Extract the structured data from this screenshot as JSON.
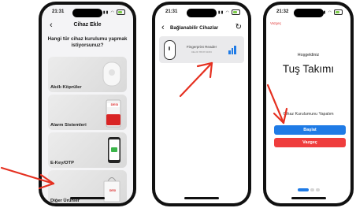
{
  "phone1": {
    "status_time": "21:31",
    "back_icon": "chevron-left-icon",
    "title": "Cihaz Ekle",
    "question": "Hangi tür cihaz kurulumu yapmak istiyorsunuz?",
    "categories": [
      {
        "label": "Akıllı Köprüler"
      },
      {
        "label": "Alarm Sistemleri",
        "device_text": "DESI"
      },
      {
        "label": "E-Key/OTP"
      },
      {
        "label": "Diğer Ürünler",
        "device_text": "DESI"
      }
    ]
  },
  "phone2": {
    "status_time": "21:31",
    "title": "Bağlanabilir Cihazlar",
    "refresh_icon": "refresh-icon",
    "device": {
      "name": "Fingerprint Reader",
      "id": "DE:2F:7B:87:00:83",
      "signal_icon": "signal-strength-icon"
    }
  },
  "phone3": {
    "status_time": "21:32",
    "skip_label": "Vazgeç",
    "welcome": "Hoşgeldiniz",
    "device_title": "Tuş Takımı",
    "intro_text": "Cihaz Kurulumunu Yapalım",
    "start_label": "Başlat",
    "cancel_label": "Vazgeç",
    "page_indicator": {
      "pages": 3,
      "active": 1
    }
  },
  "colors": {
    "accent_blue": "#1f7be6",
    "danger_red": "#ef3d3d",
    "annotation_arrow": "#e53020"
  }
}
